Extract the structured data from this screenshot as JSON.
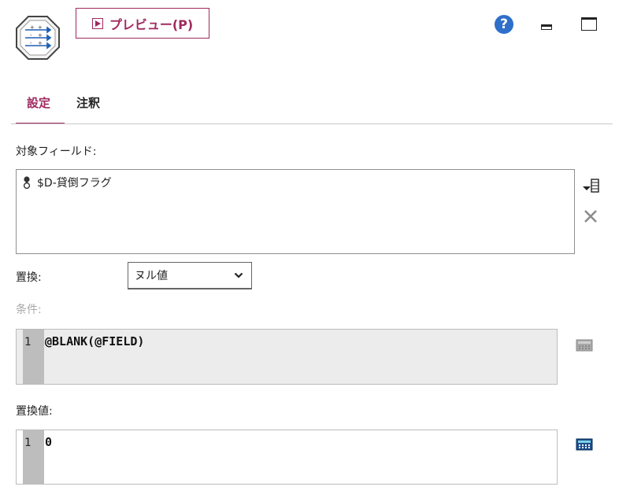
{
  "header": {
    "preview_label": "プレビュー(P)",
    "help_glyph": "?"
  },
  "tabs": [
    {
      "label": "設定",
      "active": true
    },
    {
      "label": "注釈",
      "active": false
    }
  ],
  "fields": {
    "label": "対象フィールド:",
    "items": [
      {
        "name": "$D-貸倒フラグ",
        "icon": "flag-field-icon"
      }
    ]
  },
  "replace": {
    "label": "置換:",
    "selected": "ヌル値"
  },
  "condition": {
    "label": "条件:",
    "line_number": "1",
    "code": "@BLANK(@FIELD)",
    "enabled": false
  },
  "replace_value": {
    "label": "置換値:",
    "line_number": "1",
    "code": "0",
    "enabled": true
  },
  "colors": {
    "accent": "#a0295f",
    "help_blue": "#2e6fc9"
  }
}
